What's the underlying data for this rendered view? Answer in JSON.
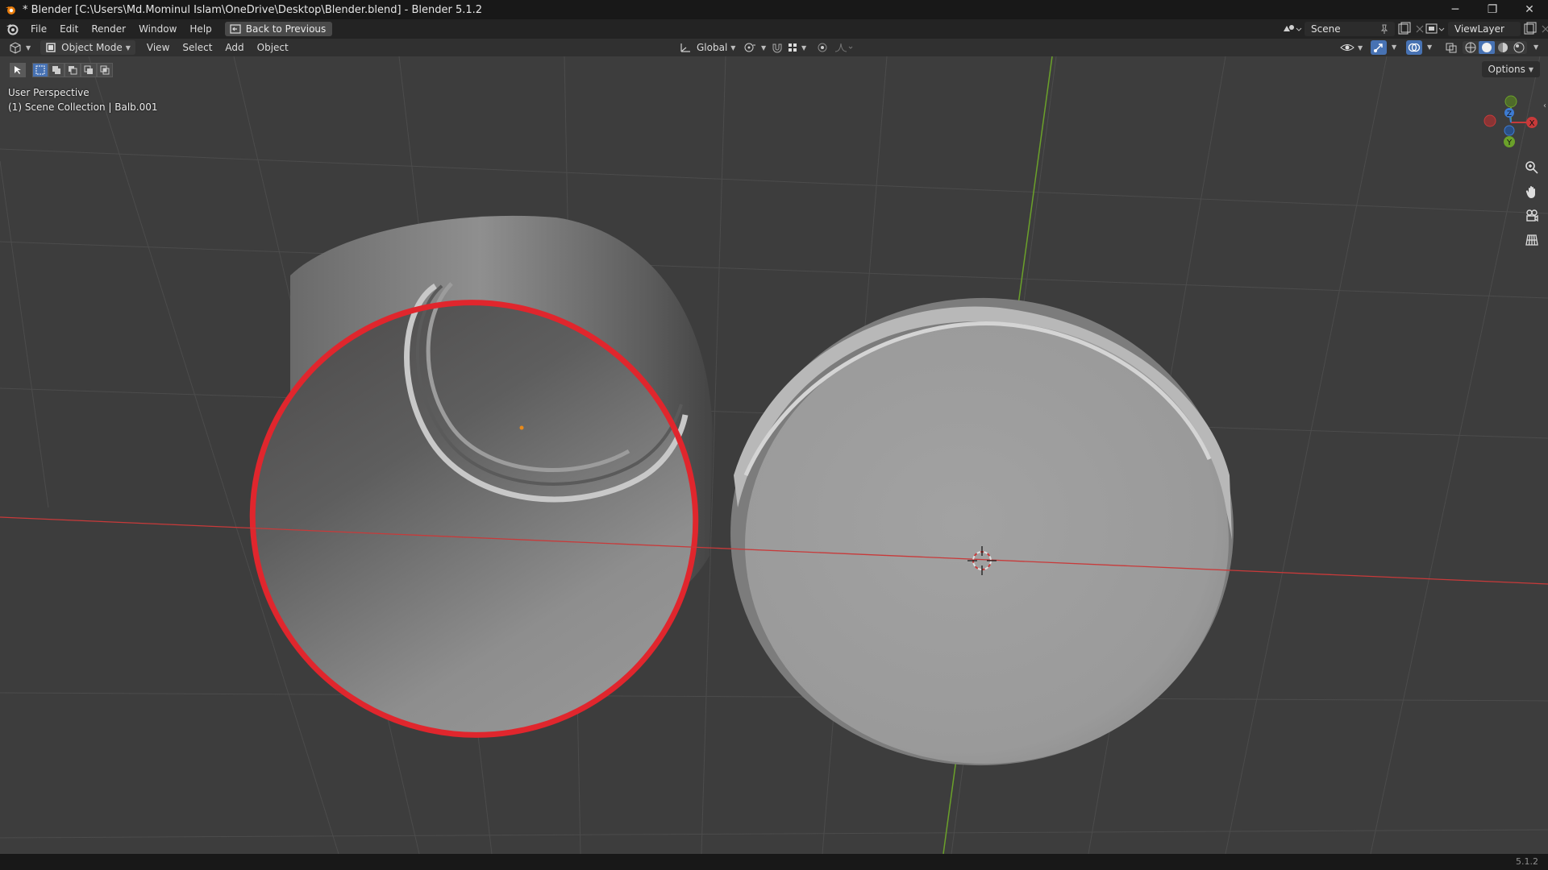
{
  "window": {
    "title": "* Blender [C:\\Users\\Md.Mominul Islam\\OneDrive\\Desktop\\Blender.blend] - Blender 5.1.2",
    "controls": [
      "─",
      "❐",
      "✕"
    ]
  },
  "topbar": {
    "menus": [
      "File",
      "Edit",
      "Render",
      "Window",
      "Help"
    ],
    "back_label": "Back to Previous",
    "scene_label": "Scene",
    "view_layer_label": "ViewLayer"
  },
  "viewport_header": {
    "mode": "Object Mode",
    "menus": [
      "View",
      "Select",
      "Add",
      "Object"
    ],
    "orientation": "Global",
    "options_label": "Options"
  },
  "viewport": {
    "perspective": "User Perspective",
    "collection": "(1) Scene Collection | Balb.001",
    "gizmo_axes": [
      "X",
      "Y",
      "Z"
    ]
  },
  "colors": {
    "selection_outline": "#e0262d",
    "x_axis": "#c83a3a",
    "y_axis": "#6ba12a",
    "grid": "#505050",
    "accent": "#4772b3"
  },
  "statusbar": {
    "version": "5.1.2"
  }
}
